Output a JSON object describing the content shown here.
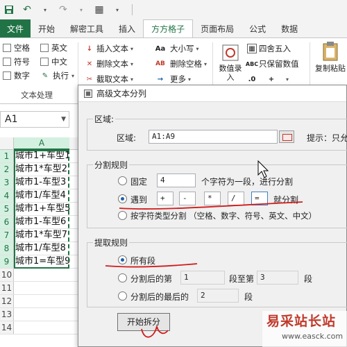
{
  "qat": {
    "save_icon": "save-icon",
    "undo_icon": "undo-icon",
    "redo_icon": "redo-icon"
  },
  "tabs": [
    {
      "label": "文件"
    },
    {
      "label": "开始"
    },
    {
      "label": "解密工具"
    },
    {
      "label": "插入"
    },
    {
      "label": "方方格子"
    },
    {
      "label": "页面布局"
    },
    {
      "label": "公式"
    },
    {
      "label": "数据"
    }
  ],
  "ribbon": {
    "text_processing": {
      "checkboxes": [
        "空格",
        "英文",
        "符号",
        "中文",
        "数字"
      ],
      "execute_label": "执行",
      "group_label": "文本处理"
    },
    "text_tools": [
      "插入文本",
      "删除文本",
      "截取文本"
    ],
    "case_tools": [
      "大小写",
      "删除空格",
      "更多"
    ],
    "numeric": {
      "round_label": "四舍五入",
      "keep_label": "只保留数值",
      "value_entry_label": "数值录入"
    },
    "paste_label": "复制粘贴"
  },
  "sheet": {
    "namebox": "A1",
    "column": "A",
    "rows": [
      {
        "n": "1",
        "text": "城市1+车型1"
      },
      {
        "n": "2",
        "text": "城市1*车型2"
      },
      {
        "n": "3",
        "text": "城市1-车型3"
      },
      {
        "n": "4",
        "text": "城市1/车型4"
      },
      {
        "n": "5",
        "text": "城市1+车型5"
      },
      {
        "n": "6",
        "text": "城市1-车型6"
      },
      {
        "n": "7",
        "text": "城市1*车型7"
      },
      {
        "n": "8",
        "text": "城市1/车型8"
      },
      {
        "n": "9",
        "text": "城市1=车型9"
      },
      {
        "n": "10",
        "text": ""
      },
      {
        "n": "11",
        "text": ""
      },
      {
        "n": "12",
        "text": ""
      },
      {
        "n": "13",
        "text": ""
      },
      {
        "n": "14",
        "text": ""
      }
    ]
  },
  "dialog": {
    "title": "高级文本分列",
    "region": {
      "legend": "区域:",
      "label": "区域:",
      "value": "A1:A9",
      "hint": "提示：只允"
    },
    "split_rules": {
      "legend": "分割规则",
      "fixed_label": "固定",
      "fixed_value": "4",
      "fixed_suffix": "个字符为一段，进行分割",
      "delim_label": "遇到",
      "delimiters": [
        "+",
        "-",
        "*",
        "/",
        "="
      ],
      "delim_suffix": "就分割",
      "type_label": "按字符类型分割 （空格、数字、符号、英文、中文）",
      "selected": "delimiters"
    },
    "extract_rules": {
      "legend": "提取规则",
      "all_label": "所有段",
      "after_label": "分割后的第",
      "after_from": "1",
      "after_mid": "段至第",
      "after_to": "3",
      "after_suffix": "段",
      "last_label": "分割后的最后的",
      "last_value": "2",
      "last_suffix": "段",
      "selected": "all"
    },
    "start_button": "开始拆分"
  },
  "watermark": {
    "main": "易采站长站",
    "sub": "www.easck.com"
  },
  "colors": {
    "accent": "#217346",
    "ink": "#d11b1b"
  }
}
